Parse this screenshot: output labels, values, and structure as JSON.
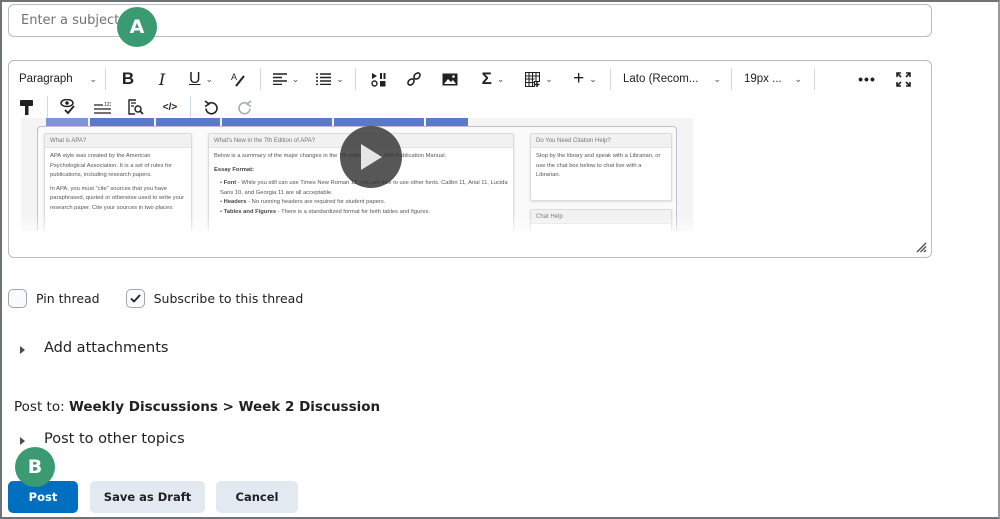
{
  "subject": {
    "placeholder": "Enter a subject",
    "value": ""
  },
  "callouts": {
    "a": "A",
    "b": "B"
  },
  "toolbar": {
    "paragraph_label": "Paragraph",
    "font_label": "Lato (Recom...",
    "size_label": "19px ...",
    "row1_icons": [
      "chevron-down-icon",
      "bold-icon",
      "italic-icon",
      "underline-icon",
      "text-format-icon",
      "align-icon",
      "list-icon",
      "media-icon",
      "link-icon",
      "image-icon",
      "equation-icon",
      "table-icon",
      "insert-icon",
      "more-icon",
      "fullscreen-icon"
    ],
    "row2_icons": [
      "format-painter-icon",
      "accessibility-check-icon",
      "word-count-icon",
      "find-replace-icon",
      "source-code-icon",
      "undo-icon",
      "redo-icon"
    ]
  },
  "video": {
    "cards": {
      "what_is_apa": {
        "title": "What is APA?",
        "p1": "APA style was created by the American Psychological Association. It is a set of rules for publications, including research papers.",
        "p2": "In APA, you must \"cite\" sources that you have paraphrased, quoted or otherwise used to write your research paper. Cite your sources in two places:"
      },
      "whats_new": {
        "title": "What's New in the 7th Edition of APA?",
        "intro": "Below is a summary of the major changes in the 7th edition of the APA Publication Manual.",
        "section": "Essay Format:",
        "bullets": [
          {
            "term": "Font",
            "text": " - While you still can use Times New Roman 12, you are free to use other fonts. Calibri 11, Arial 11, Lucida Sans 10, and Georgia 11 are all acceptable."
          },
          {
            "term": "Headers",
            "text": " - No running headers are required for student papers."
          },
          {
            "term": "Tables and Figures",
            "text": " - There is a standardized format for both tables and figures."
          }
        ]
      },
      "citation_help": {
        "title": "Do You Need Citation Help?",
        "body": "Stop by the library and speak with a Librarian, or use the chat box below to chat live with a Librarian."
      },
      "chat_help": {
        "title": "Chat Help"
      }
    }
  },
  "options": {
    "pin_thread": {
      "label": "Pin thread",
      "checked": false
    },
    "subscribe": {
      "label": "Subscribe to this thread",
      "checked": true
    }
  },
  "add_attachments": "Add attachments",
  "post_to": {
    "prefix": "Post to:",
    "destination": "Weekly Discussions > Week 2 Discussion"
  },
  "post_other_topics": "Post to other topics",
  "buttons": {
    "post": "Post",
    "save_draft": "Save as Draft",
    "cancel": "Cancel"
  },
  "colors": {
    "primary": "#006fbf",
    "secondary": "#e3e9f1",
    "callout": "#3a9b72"
  }
}
